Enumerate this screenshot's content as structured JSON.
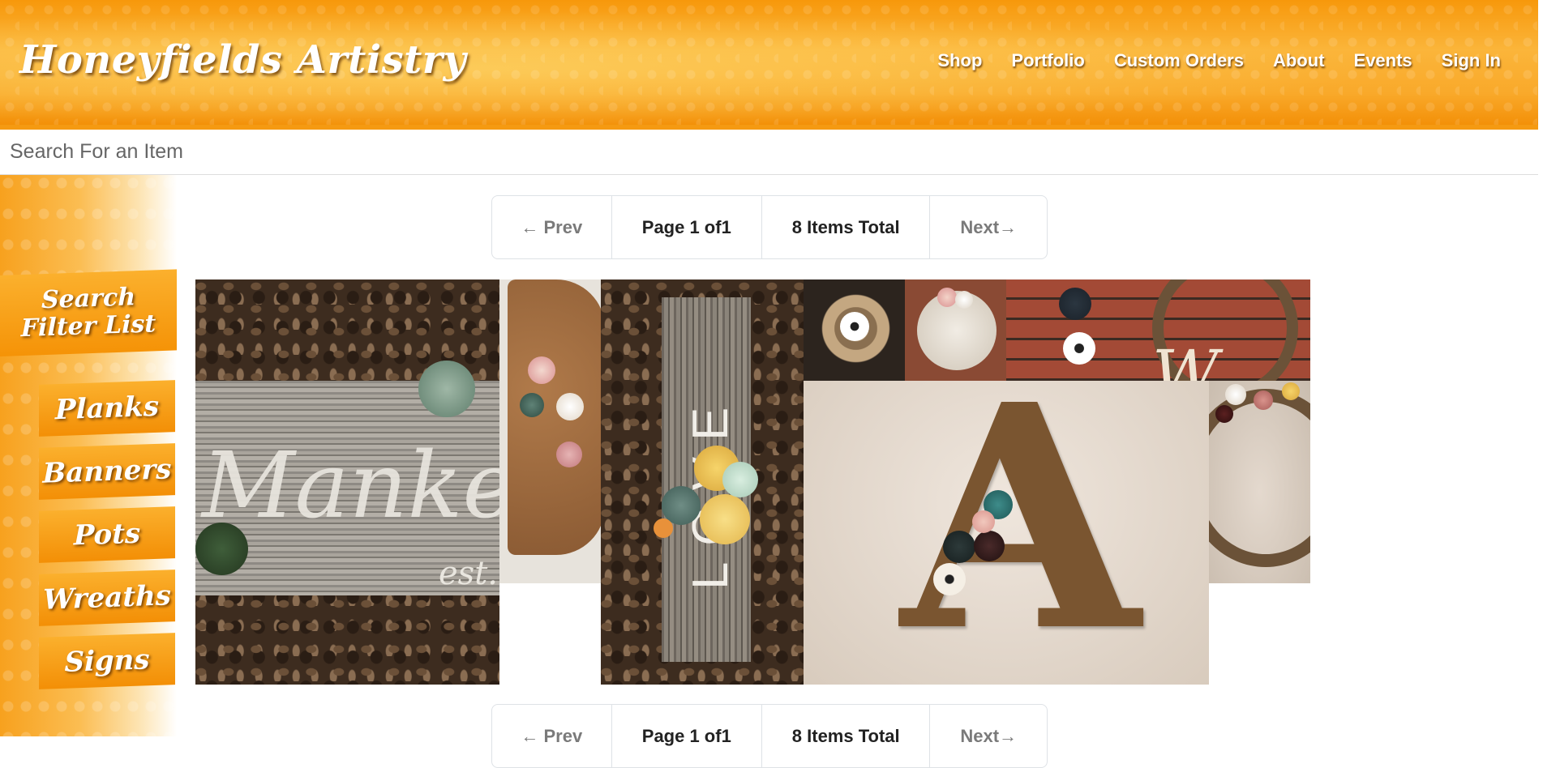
{
  "header": {
    "logo": "Honeyfields Artistry",
    "nav": [
      "Shop",
      "Portfolio",
      "Custom Orders",
      "About",
      "Events",
      "Sign In"
    ]
  },
  "search": {
    "placeholder": "Search For an Item"
  },
  "sidebar": {
    "title": "Search Filter List",
    "categories": [
      "Planks",
      "Banners",
      "Pots",
      "Wreaths",
      "Signs"
    ]
  },
  "pager": {
    "prev": "← Prev",
    "page": "Page 1 of1",
    "total": "8 Items Total",
    "next": "Next→"
  },
  "gallery": {
    "items": [
      {
        "name": "manke-plank",
        "caption_text": "Manke",
        "sub_text": "est."
      },
      {
        "name": "letter-b-floral"
      },
      {
        "name": "love-plank",
        "caption_text": "LOVE"
      },
      {
        "name": "floral-pot-top"
      },
      {
        "name": "round-wood-sign"
      },
      {
        "name": "brick-wall-wreath"
      },
      {
        "name": "letter-a-floral",
        "caption_text": "A"
      },
      {
        "name": "grapevine-wreath"
      }
    ]
  },
  "colors": {
    "header_orange": "#f7980b",
    "accent_orange": "#f59307",
    "pager_border": "#dee2e6"
  }
}
